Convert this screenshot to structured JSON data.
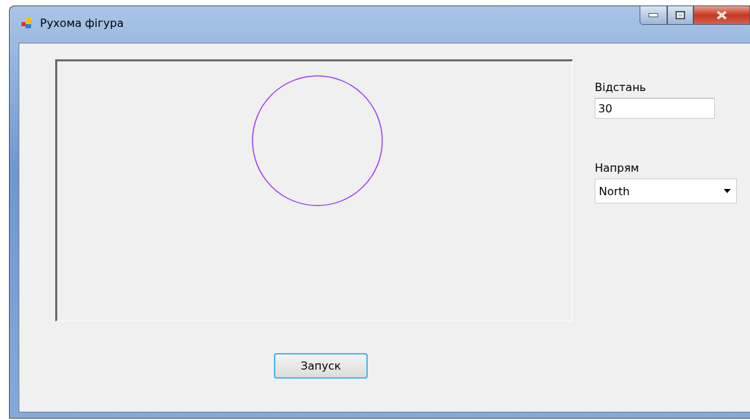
{
  "window": {
    "title": "Рухома фігура"
  },
  "fields": [
    {
      "label": "Відстань",
      "kind": "text",
      "value": "30"
    },
    {
      "label": "Напрям",
      "kind": "dropdown",
      "value": "North"
    }
  ],
  "buttons": [
    "Запуск"
  ]
}
